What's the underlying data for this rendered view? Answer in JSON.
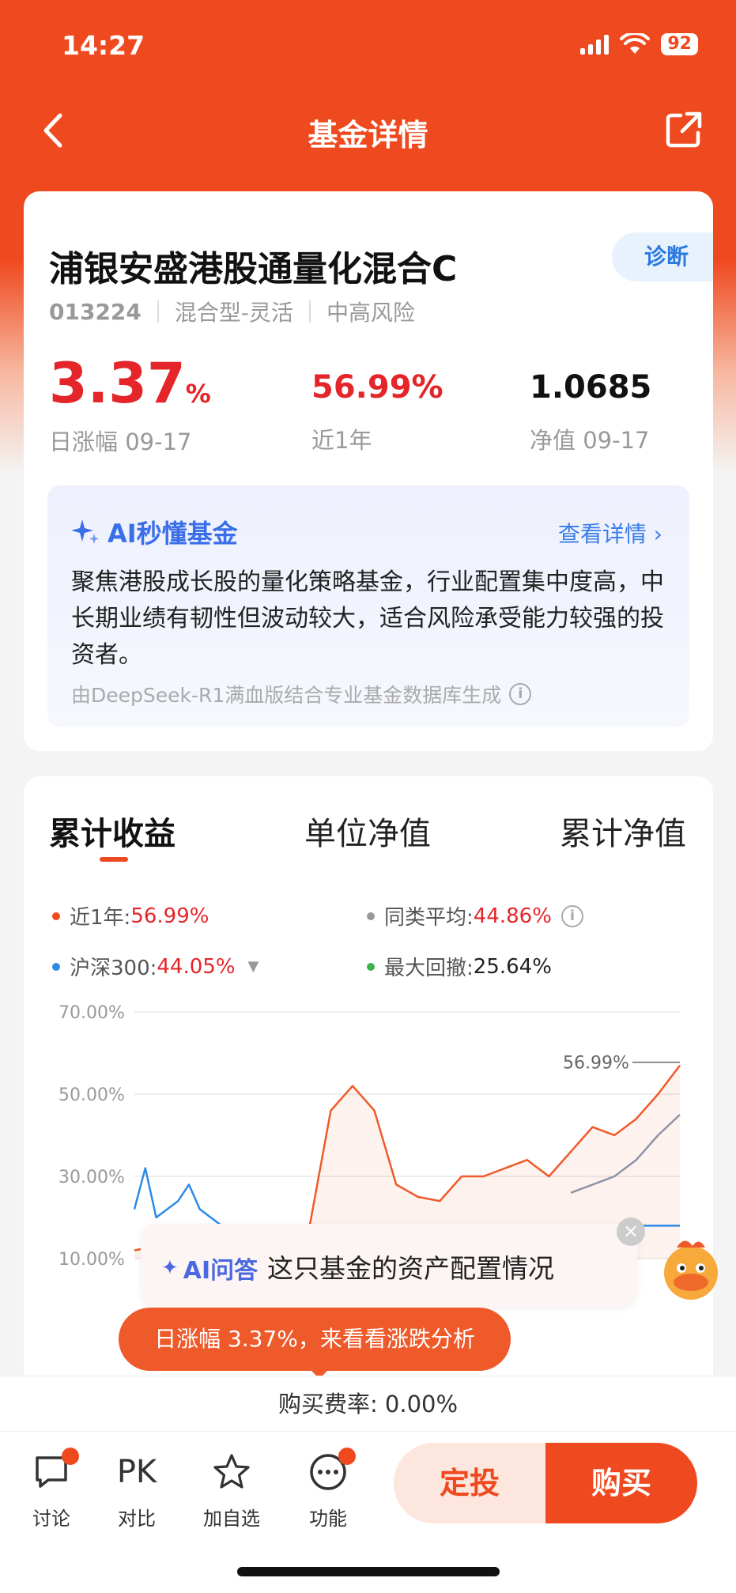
{
  "status_bar": {
    "time": "14:27",
    "battery": "92"
  },
  "nav": {
    "title": "基金详情"
  },
  "fund": {
    "name": "浦银安盛港股通量化混合C",
    "diagnose_label": "诊断",
    "code": "013224",
    "type": "混合型-灵活",
    "risk": "中高风险",
    "daily_change": "3.37",
    "daily_change_unit": "%",
    "daily_change_label": "日涨幅 09-17",
    "one_year_return": "56.99%",
    "one_year_label": "近1年",
    "nav_value": "1.0685",
    "nav_label": "净值 09-17"
  },
  "ai_summary": {
    "title": "AI秒懂基金",
    "detail_link": "查看详情",
    "text": "聚焦港股成长股的量化策略基金，行业配置集中度高，中长期业绩有韧性但波动较大，适合风险承受能力较强的投资者。",
    "note": "由DeepSeek-R1满血版结合专业基金数据库生成"
  },
  "chart_tabs": [
    "累计收益",
    "单位净值",
    "累计净值"
  ],
  "legend": {
    "one_year_label": "近1年:",
    "one_year_value": "56.99%",
    "peer_avg_label": "同类平均:",
    "peer_avg_value": "44.86%",
    "hs300_label": "沪深300:",
    "hs300_value": "44.05%",
    "max_drawdown_label": "最大回撤:",
    "max_drawdown_value": "25.64%"
  },
  "chart_data": {
    "type": "line",
    "title": "",
    "xlabel": "",
    "ylabel": "",
    "ylim": [
      10,
      70
    ],
    "y_ticks": [
      "70.00%",
      "50.00%",
      "30.00%",
      "10.00%"
    ],
    "end_label": "56.99%",
    "series": [
      {
        "name": "近1年",
        "color": "#ef5a2a",
        "x": [
          0,
          4,
          8,
          12,
          16,
          20,
          24,
          28,
          32,
          36,
          40,
          44,
          48,
          52,
          56,
          60,
          64,
          68,
          72,
          76,
          80,
          84,
          88,
          92,
          96,
          100
        ],
        "values": [
          12,
          13,
          12,
          14,
          13,
          15,
          14,
          16,
          17,
          46,
          52,
          46,
          28,
          25,
          24,
          30,
          30,
          32,
          34,
          30,
          36,
          42,
          40,
          44,
          50,
          57
        ]
      },
      {
        "name": "沪深300",
        "color": "#2d8ae8",
        "x": [
          0,
          2,
          4,
          6,
          8,
          10,
          12,
          14,
          16,
          100
        ],
        "values": [
          22,
          32,
          20,
          22,
          24,
          28,
          22,
          20,
          18,
          18
        ]
      },
      {
        "name": "同类平均",
        "color": "#8e94a8",
        "x": [
          80,
          84,
          88,
          92,
          96,
          100
        ],
        "values": [
          26,
          28,
          30,
          34,
          40,
          45
        ]
      }
    ],
    "colors": {
      "rise": "#ef5a2a",
      "drawdown": "#3cb54a"
    }
  },
  "ai_ask": {
    "label": "AI问答",
    "question": "这只基金的资产配置情况"
  },
  "tip": {
    "text": "日涨幅 3.37%，来看看涨跌分析"
  },
  "fee": {
    "text": "购买费率: 0.00%"
  },
  "bottom_bar": {
    "discuss": "讨论",
    "pk_icon": "PK",
    "pk": "对比",
    "favorite": "加自选",
    "functions": "功能",
    "sip": "定投",
    "buy": "购买"
  }
}
